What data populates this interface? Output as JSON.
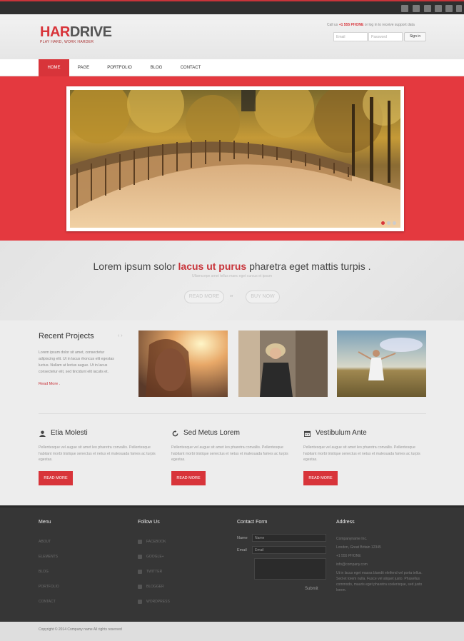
{
  "topbar": {
    "social_icons": [
      "rss-icon",
      "dribbble-icon",
      "facebook-icon",
      "twitter-icon",
      "youtube-icon",
      "vimeo-icon"
    ]
  },
  "header": {
    "logo_red": "HAR",
    "logo_dark": "DRIVE",
    "tagline": "PLAY HARD, WORK HARDER",
    "call_prefix": "Call us",
    "phone": "+1 555 PHONE",
    "call_suffix": "or log in to receive support data",
    "email_placeholder": "Email",
    "password_placeholder": "Password",
    "signin_label": "Sign in"
  },
  "nav": {
    "items": [
      "HOME",
      "PAGE",
      "PORTFOLIO",
      "BLOG",
      "CONTACT"
    ],
    "active": 0
  },
  "slider": {
    "active_dot": 0,
    "dots": 3
  },
  "band": {
    "text_before": "Lorem ipsum solor ",
    "highlight": "lacus ut purus",
    "text_after": " pharetra eget mattis turpis .",
    "sub": "Ullamcorpe amet tellus maec eget cursus et ipsum",
    "btn_read": "READ MORE",
    "or": "or",
    "btn_buy": "BUY NOW"
  },
  "recent": {
    "title": "Recent Projects",
    "arrows": "‹ ›",
    "text": "Lorem ipsum dolor sit amet, consectetur adipiscing elit. Ut in lacus rhoncus elit egestas luctus. Nullam at lectus augue. Ut in lacus consectetur elit, sed tincidunt elit iaculis et.",
    "more": "Read More ."
  },
  "features": [
    {
      "title": "Etia Molesti",
      "icon": "user-icon",
      "text": "Pellentesque vel augue sit amet leo pharetra convallis. Pellentesque habitant morbi tristique senectus et netus et malesuada fames ac turpis egestas.",
      "button": "READ MORE"
    },
    {
      "title": "Sed Metus Lorem",
      "icon": "refresh-icon",
      "text": "Pellentesque vel augue sit amet leo pharetra convallis. Pellentesque habitant morbi tristique senectus et netus et malesuada fames ac turpis egestas.",
      "button": "READ MORE"
    },
    {
      "title": "Vestibulum Ante",
      "icon": "calendar-icon",
      "text": "Pellentesque vel augue sit amet leo pharetra convallis. Pellentesque habitant morbi tristique senectus et netus et malesuada fames ac turpis egestas.",
      "button": "READ MORE"
    }
  ],
  "footer": {
    "menu_title": "Menu",
    "menu": [
      "ABOUT",
      "ELEMENTS",
      "BLOG",
      "PORTFOLIO",
      "CONTACT"
    ],
    "follow_title": "Follow Us",
    "follow": [
      "FACEBOOK",
      "GOOGLE+",
      "TWITTER",
      "BLOGGER",
      "WORDPRESS"
    ],
    "contact_title": "Contact Form",
    "name_label": "Name",
    "name_placeholder": "Name",
    "email_label": "Email",
    "email_placeholder": "Email",
    "submit": "Submit",
    "address_title": "Address",
    "address_lines": [
      "Companyname Inc.",
      "London, Great Britain 12345",
      "+1 555 PHONE",
      "info@company.com"
    ],
    "address_text": "Ut in lacus eget massa blandit eleifend vel porta tellus. Sed et lorem nulla. Fusce vel aliquet justo. Phasellus commodo, mauris eget pharetra scelerisque, sed justo lorem."
  },
  "copyright": "Copyright © 2014 Company name All rights reserved",
  "colors": {
    "accent": "#d8343a",
    "footer": "#363636"
  }
}
